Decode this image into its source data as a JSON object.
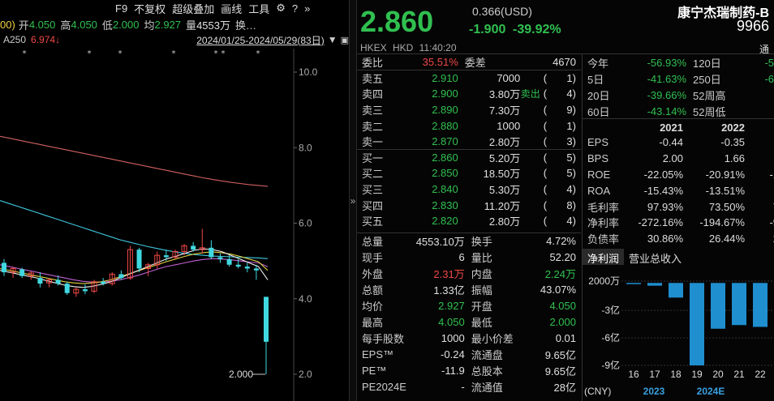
{
  "toolbar": {
    "left_frag": "00)",
    "open_label": "开",
    "open_val": "4.050",
    "high_label": "高",
    "high_val": "4.050",
    "low_label": "低",
    "low_val": "2.000",
    "avg_label": "均",
    "avg_val": "2.927",
    "vol_label": "量",
    "vol_val": "4553万",
    "more_label": "换…",
    "f9": "F9",
    "no_adjust": "不复权",
    "overlay": "超级叠加",
    "draw": "画线",
    "tools": "工具"
  },
  "chart_info": {
    "ma_label": "A250",
    "ma_val": "6.974",
    "range": "2024/01/25-2024/05/29(83日)"
  },
  "chart_data": {
    "type": "candlestick",
    "y_ticks": [
      10.0,
      8.0,
      6.0,
      4.0,
      2.0
    ],
    "y_tick_labels": [
      "10.0",
      "8.0",
      "6.0",
      "4.0",
      "2.0"
    ],
    "ylim": [
      1.3,
      10.5
    ],
    "low_marker": "2.000",
    "candles": [
      {
        "o": 4.95,
        "h": 5.05,
        "l": 4.6,
        "c": 4.7
      },
      {
        "o": 4.7,
        "h": 4.85,
        "l": 4.55,
        "c": 4.8
      },
      {
        "o": 4.78,
        "h": 4.82,
        "l": 4.55,
        "c": 4.6
      },
      {
        "o": 4.6,
        "h": 4.72,
        "l": 4.5,
        "c": 4.68
      },
      {
        "o": 4.55,
        "h": 4.7,
        "l": 4.3,
        "c": 4.4
      },
      {
        "o": 4.42,
        "h": 4.55,
        "l": 4.3,
        "c": 4.5
      },
      {
        "o": 4.5,
        "h": 4.62,
        "l": 4.35,
        "c": 4.4
      },
      {
        "o": 4.4,
        "h": 4.45,
        "l": 4.1,
        "c": 4.15
      },
      {
        "o": 4.15,
        "h": 4.3,
        "l": 4.05,
        "c": 4.25
      },
      {
        "o": 4.25,
        "h": 4.38,
        "l": 4.12,
        "c": 4.2
      },
      {
        "o": 4.2,
        "h": 4.5,
        "l": 4.15,
        "c": 4.45
      },
      {
        "o": 4.45,
        "h": 4.55,
        "l": 4.35,
        "c": 4.4
      },
      {
        "o": 4.4,
        "h": 4.7,
        "l": 4.35,
        "c": 4.65
      },
      {
        "o": 4.65,
        "h": 4.75,
        "l": 4.5,
        "c": 4.55
      },
      {
        "o": 4.55,
        "h": 5.4,
        "l": 4.5,
        "c": 5.3
      },
      {
        "o": 5.3,
        "h": 5.35,
        "l": 4.7,
        "c": 4.8
      },
      {
        "o": 4.8,
        "h": 4.95,
        "l": 4.6,
        "c": 4.9
      },
      {
        "o": 4.9,
        "h": 5.25,
        "l": 4.8,
        "c": 5.15
      },
      {
        "o": 5.15,
        "h": 5.3,
        "l": 5.0,
        "c": 5.1
      },
      {
        "o": 5.1,
        "h": 5.3,
        "l": 5.05,
        "c": 5.25
      },
      {
        "o": 5.25,
        "h": 5.45,
        "l": 5.15,
        "c": 5.4
      },
      {
        "o": 5.4,
        "h": 5.5,
        "l": 5.25,
        "c": 5.3
      },
      {
        "o": 5.3,
        "h": 5.85,
        "l": 5.2,
        "c": 5.35
      },
      {
        "o": 5.35,
        "h": 5.55,
        "l": 5.05,
        "c": 5.1
      },
      {
        "o": 5.1,
        "h": 5.2,
        "l": 4.95,
        "c": 5.05
      },
      {
        "o": 5.05,
        "h": 5.15,
        "l": 4.85,
        "c": 4.9
      },
      {
        "o": 4.9,
        "h": 5.05,
        "l": 4.8,
        "c": 4.85
      },
      {
        "o": 4.85,
        "h": 4.95,
        "l": 4.7,
        "c": 4.8
      },
      {
        "o": 4.8,
        "h": 4.9,
        "l": 4.5,
        "c": 4.75
      },
      {
        "o": 4.05,
        "h": 4.05,
        "l": 2.0,
        "c": 2.86
      }
    ],
    "ma250": [
      8.3,
      8.25,
      8.2,
      8.15,
      8.1,
      8.05,
      8.0,
      7.95,
      7.9,
      7.85,
      7.8,
      7.75,
      7.7,
      7.65,
      7.6,
      7.55,
      7.5,
      7.45,
      7.4,
      7.35,
      7.3,
      7.25,
      7.2,
      7.16,
      7.12,
      7.08,
      7.05,
      7.02,
      7.0,
      6.974
    ],
    "ma120": [
      6.6,
      6.52,
      6.44,
      6.36,
      6.28,
      6.2,
      6.12,
      6.04,
      5.96,
      5.88,
      5.8,
      5.72,
      5.64,
      5.56,
      5.5,
      5.44,
      5.38,
      5.33,
      5.28,
      5.24,
      5.2,
      5.17,
      5.15,
      5.13,
      5.12,
      5.11,
      5.1,
      5.09,
      5.08,
      5.06
    ],
    "ma60": [
      4.9,
      4.85,
      4.8,
      4.75,
      4.7,
      4.65,
      4.6,
      4.55,
      4.5,
      4.46,
      4.44,
      4.44,
      4.46,
      4.5,
      4.56,
      4.62,
      4.7,
      4.78,
      4.85,
      4.9,
      4.95,
      5.0,
      5.04,
      5.06,
      5.05,
      5.03,
      5.0,
      4.97,
      4.95,
      4.85
    ],
    "ma20": [
      4.8,
      4.75,
      4.7,
      4.65,
      4.6,
      4.55,
      4.5,
      4.45,
      4.42,
      4.4,
      4.42,
      4.45,
      4.5,
      4.58,
      4.66,
      4.74,
      4.82,
      4.9,
      4.98,
      5.05,
      5.12,
      5.18,
      5.22,
      5.24,
      5.22,
      5.18,
      5.12,
      5.05,
      4.98,
      4.75
    ],
    "ma10": [
      4.75,
      4.7,
      4.65,
      4.6,
      4.55,
      4.48,
      4.42,
      4.36,
      4.32,
      4.3,
      4.33,
      4.38,
      4.45,
      4.55,
      4.65,
      4.75,
      4.85,
      4.95,
      5.05,
      5.12,
      5.2,
      5.28,
      5.32,
      5.3,
      5.25,
      5.15,
      5.05,
      4.95,
      4.85,
      4.5
    ]
  },
  "quote": {
    "price": "2.860",
    "usd": "0.366(USD)",
    "change": "-1.900",
    "change_pct": "-39.92%",
    "name": "康宁杰瑞制药-B",
    "code": "9966",
    "exchange": "HKEX HKD 11:40:20",
    "tong": "通"
  },
  "orderbook": {
    "ratio_label": "委比",
    "ratio_val": "35.51%",
    "diff_label": "委差",
    "diff_val": "4670",
    "asks": [
      {
        "label": "卖五",
        "price": "2.910",
        "vol": "7000",
        "cnt": "1"
      },
      {
        "label": "卖四",
        "price": "2.900",
        "vol": "3.80万",
        "tag": "卖出",
        "cnt": "4"
      },
      {
        "label": "卖三",
        "price": "2.890",
        "vol": "7.30万",
        "cnt": "9"
      },
      {
        "label": "卖二",
        "price": "2.880",
        "vol": "1000",
        "cnt": "1"
      },
      {
        "label": "卖一",
        "price": "2.870",
        "vol": "2.80万",
        "cnt": "3"
      }
    ],
    "bids": [
      {
        "label": "买一",
        "price": "2.860",
        "vol": "5.20万",
        "cnt": "5"
      },
      {
        "label": "买二",
        "price": "2.850",
        "vol": "18.50万",
        "cnt": "5"
      },
      {
        "label": "买三",
        "price": "2.840",
        "vol": "5.30万",
        "cnt": "4"
      },
      {
        "label": "买四",
        "price": "2.830",
        "vol": "11.20万",
        "cnt": "8"
      },
      {
        "label": "买五",
        "price": "2.820",
        "vol": "2.80万",
        "cnt": "4"
      }
    ]
  },
  "stats": [
    {
      "l": "总量",
      "v": "4553.10万",
      "vc": "wh",
      "l2": "换手",
      "v2": "4.72%",
      "v2c": "wh"
    },
    {
      "l": "现手",
      "v": "6",
      "vc": "wh",
      "l2": "量比",
      "v2": "52.20",
      "v2c": "wh"
    },
    {
      "l": "外盘",
      "v": "2.31万",
      "vc": "up",
      "l2": "内盘",
      "v2": "2.24万",
      "v2c": "dn"
    },
    {
      "l": "总额",
      "v": "1.33亿",
      "vc": "wh",
      "l2": "振幅",
      "v2": "43.07%",
      "v2c": "wh"
    },
    {
      "l": "均价",
      "v": "2.927",
      "vc": "dn",
      "l2": "开盘",
      "v2": "4.050",
      "v2c": "dn"
    },
    {
      "l": "最高",
      "v": "4.050",
      "vc": "dn",
      "l2": "最低",
      "v2": "2.000",
      "v2c": "dn"
    },
    {
      "l": "每手股数",
      "v": "1000",
      "vc": "wh",
      "l2": "最小价差",
      "v2": "0.01",
      "v2c": "wh"
    },
    {
      "l": "EPS™",
      "v": "-0.24",
      "vc": "wh",
      "l2": "流通盘",
      "v2": "9.65亿",
      "v2c": "wh"
    },
    {
      "l": "PE™",
      "v": "-11.9",
      "vc": "wh",
      "l2": "总股本",
      "v2": "9.65亿",
      "v2c": "wh"
    },
    {
      "l": "PE2024E",
      "v": "-",
      "vc": "wh",
      "l2": "流通值",
      "v2": "28亿",
      "v2c": "wh"
    }
  ],
  "perf": [
    {
      "l": "今年",
      "v": "-56.93%",
      "l2": "120日",
      "v2": "-5"
    },
    {
      "l": "5日",
      "v": "-41.63%",
      "l2": "250日",
      "v2": "-6"
    },
    {
      "l": "20日",
      "v": "-39.66%",
      "l2": "52周高",
      "v2": ""
    },
    {
      "l": "60日",
      "v": "-43.14%",
      "l2": "52周低",
      "v2": ""
    }
  ],
  "fin": {
    "years": [
      "2021",
      "2022",
      ""
    ],
    "rows": [
      {
        "l": "EPS",
        "a": "-0.44",
        "b": "-0.35",
        "c": ""
      },
      {
        "l": "BPS",
        "a": "2.00",
        "b": "1.66",
        "c": ""
      },
      {
        "l": "ROE",
        "a": "-22.05%",
        "b": "-20.91%",
        "c": "-1"
      },
      {
        "l": "ROA",
        "a": "-15.43%",
        "b": "-13.51%",
        "c": "-"
      },
      {
        "l": "毛利率",
        "a": "97.93%",
        "b": "73.50%",
        "c": "7"
      },
      {
        "l": "净利率",
        "a": "-272.16%",
        "b": "-194.67%",
        "c": "-9"
      },
      {
        "l": "负债率",
        "a": "30.86%",
        "b": "26.44%",
        "c": "2"
      }
    ]
  },
  "tabs": [
    "净利润",
    "营业总收入"
  ],
  "bar_chart": {
    "type": "bar",
    "y_labels": [
      "2000万",
      "-3亿",
      "-6亿",
      "-9亿"
    ],
    "x_labels": [
      "16",
      "17",
      "18",
      "19",
      "20",
      "21",
      "22"
    ],
    "currency": "(CNY)",
    "year_a": "2023",
    "year_b": "2024E",
    "values": [
      0,
      -0.3,
      -1.6,
      -9.0,
      -5.0,
      -4.6,
      -4.8
    ]
  },
  "colors": {
    "up": "#f04848",
    "down": "#30c050",
    "bar": "#1f8fd0"
  }
}
